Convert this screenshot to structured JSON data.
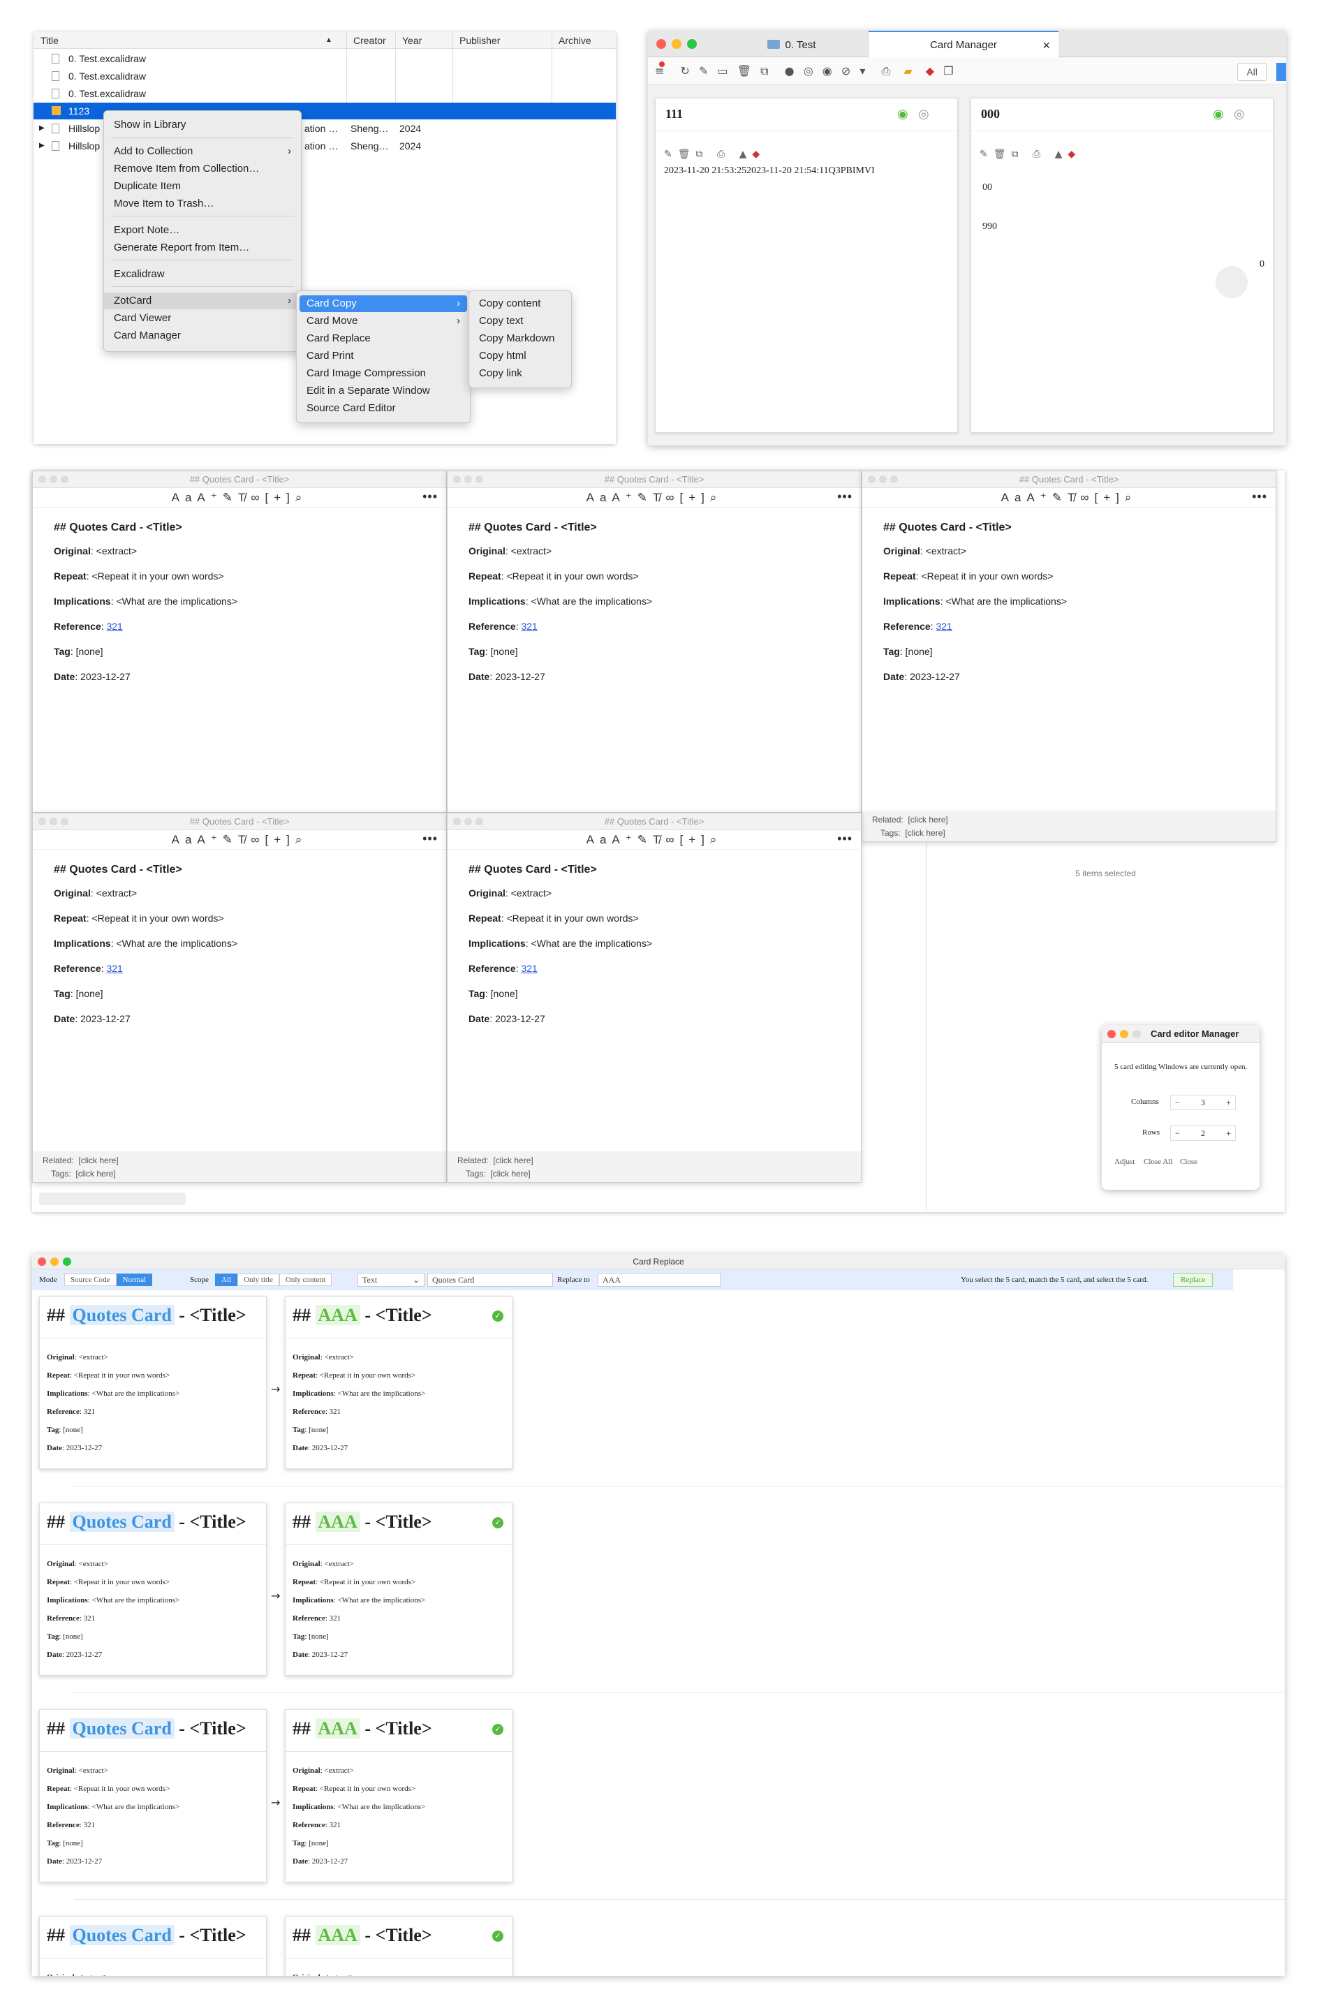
{
  "library": {
    "columns": [
      "Title",
      "Creator",
      "Year",
      "Publisher",
      "Archive"
    ],
    "rows": [
      {
        "title": "0. Test.excalidraw",
        "creator": "",
        "year": ""
      },
      {
        "title": "0. Test.excalidraw",
        "creator": "",
        "year": ""
      },
      {
        "title": "0. Test.excalidraw",
        "creator": "",
        "year": ""
      },
      {
        "title": "1123",
        "creator": "",
        "year": ""
      },
      {
        "title": "Hillslop",
        "creator": "Sheng…",
        "year": "2024",
        "publisher_partial": "ation …"
      },
      {
        "title": "Hillslop",
        "creator": "Sheng…",
        "year": "2024",
        "publisher_partial": "ation …"
      }
    ],
    "context_menu": [
      "Show in Library",
      "Add to Collection",
      "Remove Item from Collection…",
      "Duplicate Item",
      "Move Item to Trash…",
      "Export Note…",
      "Generate Report from Item…",
      "Excalidraw",
      "ZotCard",
      "Card Viewer",
      "Card Manager"
    ],
    "zotcard_menu": [
      "Card Copy",
      "Card Move",
      "Card Replace",
      "Card Print",
      "Card Image Compression",
      "Edit in a Separate Window",
      "Source Card Editor"
    ],
    "copy_menu": [
      "Copy content",
      "Copy text",
      "Copy Markdown",
      "Copy html",
      "Copy link"
    ]
  },
  "card_manager": {
    "tab1": "0. Test",
    "tab2": "Card Manager",
    "close": "×",
    "all_button": "All",
    "card1": {
      "title": "111",
      "content": "2023-11-20 21:53:252023-11-20 21:54:11Q3PBIMVI"
    },
    "card2": {
      "title": "000",
      "line1": "00",
      "line2": "990",
      "count": "0"
    }
  },
  "editor": {
    "window_title": "## Quotes Card - <Title>",
    "heading": "## Quotes Card - <Title>",
    "original_label": "Original",
    "original_value": ": <extract>",
    "repeat_label": "Repeat",
    "repeat_value": ": <Repeat it in your own words>",
    "implications_label": "Implications",
    "implications_value": ": <What are the implications>",
    "reference_label": "Reference",
    "reference_value": "321",
    "tag_label": "Tag",
    "tag_value": ": [none]",
    "date_label": "Date",
    "date_value": ": 2023-12-27",
    "related_label": "Related:",
    "tags_label": "Tags:",
    "click_here": "[click here]",
    "items_selected": "5 items selected"
  },
  "editor_manager": {
    "title": "Card editor Manager",
    "message": "5 card editing Windows are currently open.",
    "columns_label": "Columns",
    "columns_value": "3",
    "rows_label": "Rows",
    "rows_value": "2",
    "minus": "−",
    "plus": "+",
    "adjust": "Adjust",
    "close_all": "Close All",
    "close": "Close"
  },
  "replace": {
    "title": "Card Replace",
    "mode_label": "Mode",
    "source_code": "Source Code",
    "normal": "Normal",
    "scope_label": "Scope",
    "all": "All",
    "only_title": "Only title",
    "only_content": "Only content",
    "type": "Text",
    "search": "Quotes Card",
    "replace_to_label": "Replace to",
    "replace_value": "AAA",
    "status": "You select the 5 card, match the 5 card, and select the 5 card.",
    "replace_button": "Replace",
    "left_prefix": "##",
    "left_match": "Quotes Card",
    "suffix": "- <Title>",
    "right_match": "AAA",
    "arrow": "→",
    "check": "✓",
    "original": "Original",
    "original_v": ": <extract>",
    "repeat": "Repeat",
    "repeat_v": ": <Repeat it in your own words>",
    "implications": "Implications",
    "implications_v": ": <What are the implications>",
    "reference": "Reference",
    "reference_v": ": 321",
    "tag": "Tag",
    "tag_v": ": [none]",
    "date": "Date",
    "date_v": ": 2023-12-27"
  }
}
